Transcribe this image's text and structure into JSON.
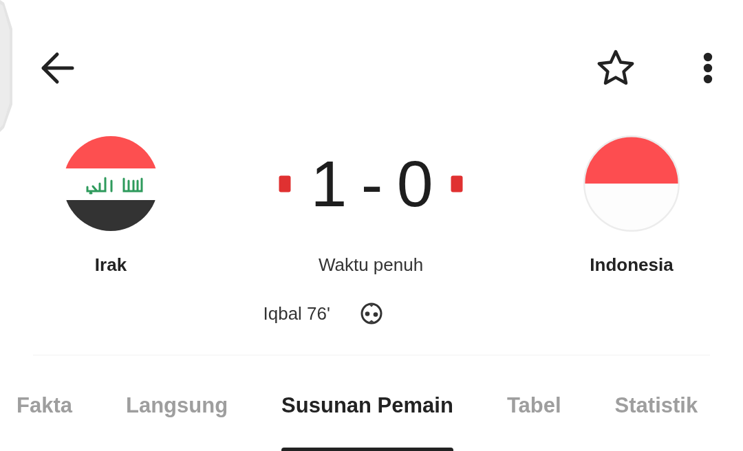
{
  "top_bar": {
    "favorite": false
  },
  "match": {
    "home": {
      "name": "Irak",
      "red_card": true,
      "goals": [
        "Iqbal 76'"
      ]
    },
    "score": "1 - 0",
    "status": "Waktu penuh",
    "away": {
      "name": "Indonesia",
      "red_card": true
    }
  },
  "tabs": [
    {
      "label": "Fakta",
      "selected": false
    },
    {
      "label": "Langsung",
      "selected": false
    },
    {
      "label": "Susunan Pemain",
      "selected": true
    },
    {
      "label": "Tabel",
      "selected": false
    },
    {
      "label": "Statistik",
      "selected": false
    }
  ]
}
